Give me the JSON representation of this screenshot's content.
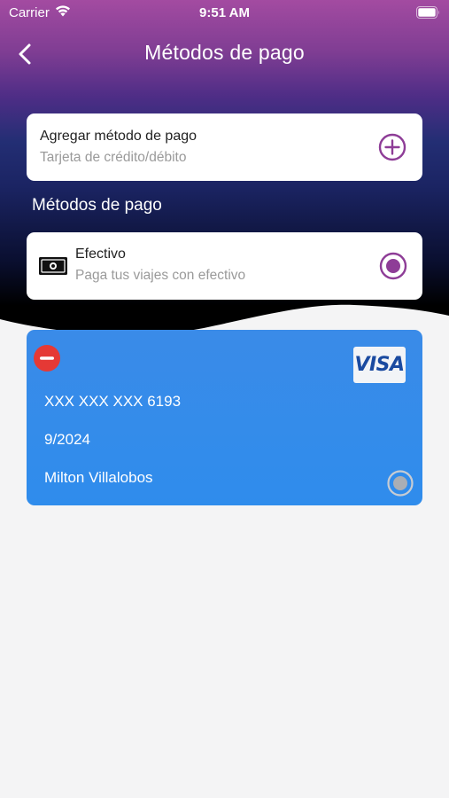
{
  "status_bar": {
    "carrier": "Carrier",
    "time": "9:51 AM"
  },
  "nav": {
    "title": "Métodos de pago",
    "back_icon": "chevron-left-icon"
  },
  "add_method": {
    "title": "Agregar método de pago",
    "subtitle": "Tarjeta de crédito/débito",
    "icon": "plus-circle-icon"
  },
  "section": {
    "title": "Métodos de pago"
  },
  "cash": {
    "title": "Efectivo",
    "subtitle": "Paga tus viajes con efectivo",
    "selected": true
  },
  "card": {
    "brand": "VISA",
    "number": "XXX XXX XXX 6193",
    "expiry": "9/2024",
    "holder": "Milton Villalobos",
    "selected": false
  },
  "colors": {
    "accent": "#8e3d97",
    "card_blue": "#2f8cec",
    "remove_red": "#e53935"
  }
}
